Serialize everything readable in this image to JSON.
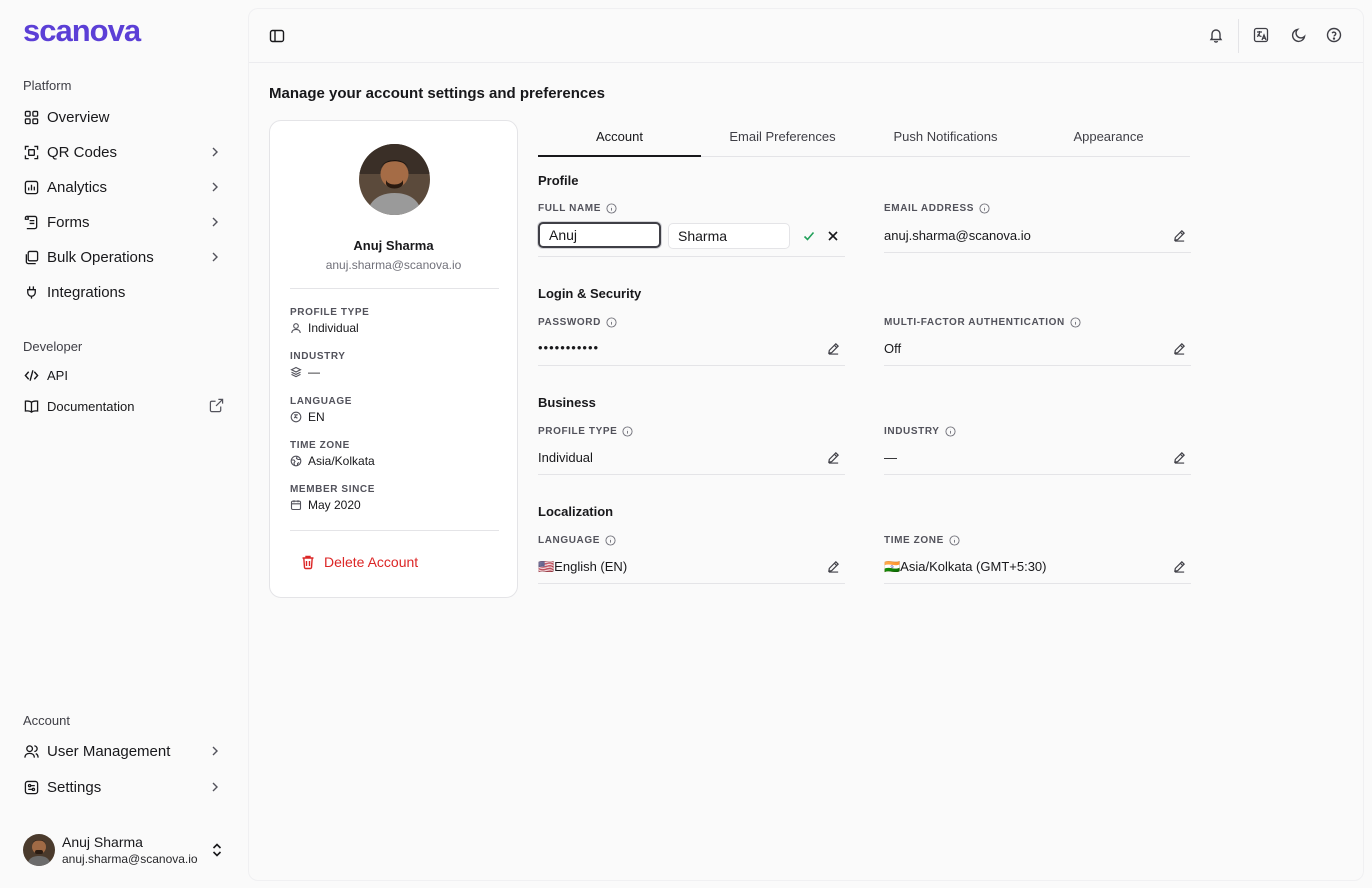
{
  "brand": {
    "logo_text": "scanova",
    "accent": "#5b3fd6"
  },
  "sidebar": {
    "platform_label": "Platform",
    "platform_items": [
      {
        "label": "Overview",
        "icon": "grid-icon",
        "has_chevron": false
      },
      {
        "label": "QR Codes",
        "icon": "qr-code-icon",
        "has_chevron": true
      },
      {
        "label": "Analytics",
        "icon": "bar-chart-icon",
        "has_chevron": true
      },
      {
        "label": "Forms",
        "icon": "form-icon",
        "has_chevron": true
      },
      {
        "label": "Bulk Operations",
        "icon": "stack-icon",
        "has_chevron": true
      },
      {
        "label": "Integrations",
        "icon": "plug-icon",
        "has_chevron": false
      }
    ],
    "developer_label": "Developer",
    "developer_items": [
      {
        "label": "API",
        "icon": "code-icon"
      },
      {
        "label": "Documentation",
        "icon": "book-icon",
        "external": true
      }
    ],
    "account_label": "Account",
    "account_items": [
      {
        "label": "User Management",
        "icon": "users-icon",
        "has_chevron": true
      },
      {
        "label": "Settings",
        "icon": "settings-icon",
        "has_chevron": true
      }
    ],
    "user": {
      "name": "Anuj Sharma",
      "email": "anuj.sharma@scanova.io"
    }
  },
  "topbar": {
    "icons": [
      "sidebar-toggle-icon",
      "bell-icon",
      "language-icon",
      "moon-icon",
      "help-icon"
    ]
  },
  "page": {
    "heading": "Manage your account settings and preferences"
  },
  "profile_card": {
    "name": "Anuj Sharma",
    "email": "anuj.sharma@scanova.io",
    "profile_type_label": "PROFILE TYPE",
    "profile_type_value": "Individual",
    "industry_label": "INDUSTRY",
    "industry_value": "—",
    "language_label": "LANGUAGE",
    "language_value": "EN",
    "time_zone_label": "TIME ZONE",
    "time_zone_value": "Asia/Kolkata",
    "member_since_label": "MEMBER SINCE",
    "member_since_value": "May 2020",
    "delete_label": "Delete Account",
    "danger_color": "#dc2626"
  },
  "tabs": [
    {
      "label": "Account",
      "active": true
    },
    {
      "label": "Email Preferences",
      "active": false
    },
    {
      "label": "Push Notifications",
      "active": false
    },
    {
      "label": "Appearance",
      "active": false
    }
  ],
  "sections": {
    "profile": {
      "title": "Profile",
      "full_name_label": "FULL NAME",
      "first_name_value": "Anuj",
      "last_name_value": "Sharma",
      "email_label": "EMAIL ADDRESS",
      "email_value": "anuj.sharma@scanova.io"
    },
    "security": {
      "title": "Login & Security",
      "password_label": "PASSWORD",
      "password_value": "•••••••••••",
      "mfa_label": "MULTI-FACTOR AUTHENTICATION",
      "mfa_value": "Off"
    },
    "business": {
      "title": "Business",
      "profile_type_label": "PROFILE TYPE",
      "profile_type_value": "Individual",
      "industry_label": "INDUSTRY",
      "industry_value": "—"
    },
    "localization": {
      "title": "Localization",
      "language_label": "LANGUAGE",
      "language_value": "🇺🇸English (EN)",
      "time_zone_label": "TIME ZONE",
      "time_zone_value": "🇮🇳Asia/Kolkata (GMT+5:30)"
    }
  }
}
